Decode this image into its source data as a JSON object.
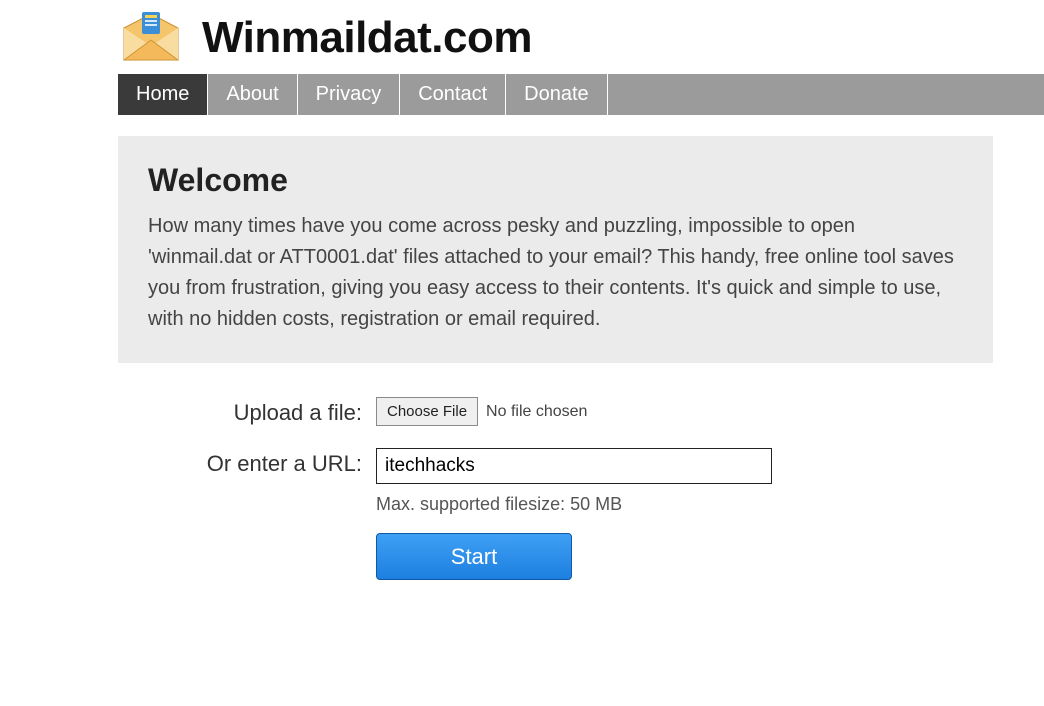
{
  "header": {
    "site_title": "Winmaildat.com",
    "logo_name": "envelope-logo-icon"
  },
  "nav": {
    "items": [
      {
        "label": "Home",
        "active": true
      },
      {
        "label": "About",
        "active": false
      },
      {
        "label": "Privacy",
        "active": false
      },
      {
        "label": "Contact",
        "active": false
      },
      {
        "label": "Donate",
        "active": false
      }
    ]
  },
  "welcome": {
    "title": "Welcome",
    "body": "How many times have you come across pesky and puzzling, impossible to open 'winmail.dat or ATT0001.dat' files attached to your email? This handy, free online tool saves you from frustration, giving you easy access to their contents. It's quick and simple to use, with no hidden costs, registration or email required."
  },
  "form": {
    "upload_label": "Upload a file:",
    "choose_file_label": "Choose File",
    "no_file_text": "No file chosen",
    "url_label": "Or enter a URL:",
    "url_value": "itechhacks",
    "filesize_note": "Max. supported filesize: 50 MB",
    "start_label": "Start"
  }
}
